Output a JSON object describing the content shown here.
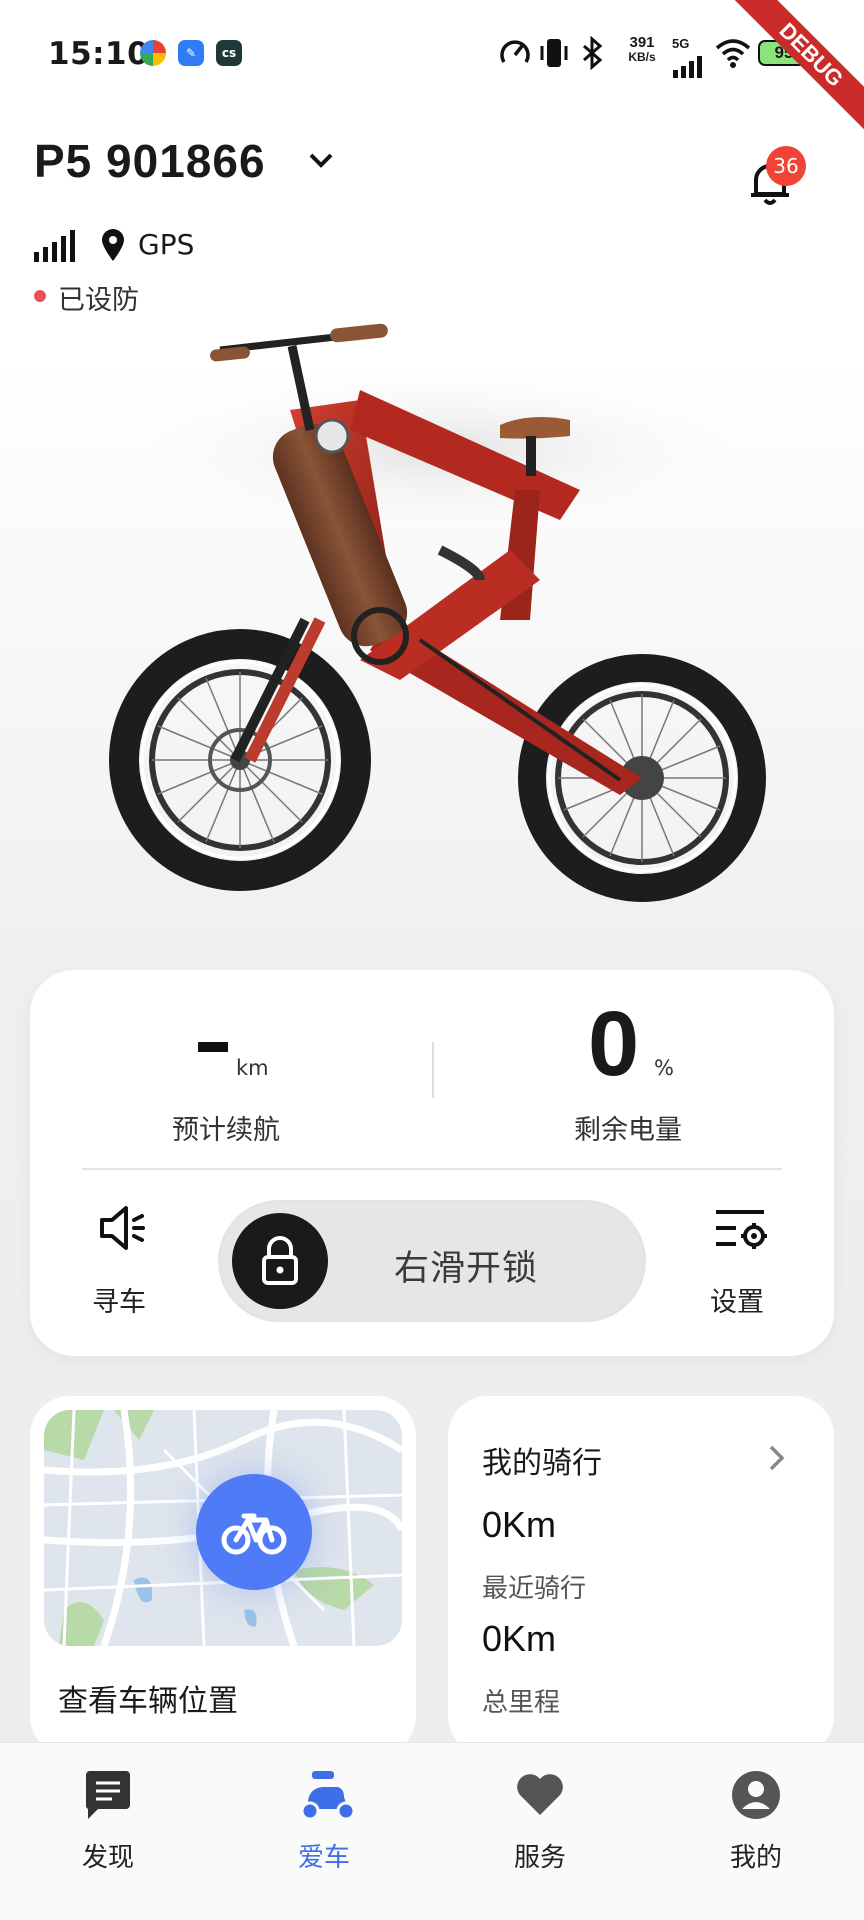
{
  "status_bar": {
    "time": "15:10",
    "net_speed_value": "391",
    "net_speed_unit": "KB/s",
    "network_type": "5G",
    "battery": "95",
    "debug_label": "DEBUG"
  },
  "header": {
    "vehicle_name": "P5 901866",
    "notification_count": "36",
    "gps_label": "GPS",
    "lock_status": "已设防"
  },
  "stats": {
    "range_value": "-",
    "range_unit": "km",
    "range_label": "预计续航",
    "battery_value": "0",
    "battery_unit": "%",
    "battery_label": "剩余电量",
    "find_label": "寻车",
    "slider_label": "右滑开锁",
    "settings_label": "设置"
  },
  "map_card": {
    "caption": "查看车辆位置"
  },
  "ride_card": {
    "title": "我的骑行",
    "recent_value": "0Km",
    "recent_label": "最近骑行",
    "total_value": "0Km",
    "total_label": "总里程"
  },
  "nav": {
    "items": [
      {
        "label": "发现",
        "icon": "chat-icon"
      },
      {
        "label": "爱车",
        "icon": "scooter-icon"
      },
      {
        "label": "服务",
        "icon": "heart-icon"
      },
      {
        "label": "我的",
        "icon": "person-icon"
      }
    ],
    "active_index": 1
  },
  "colors": {
    "accent": "#3e6ee8",
    "map_marker": "#4f7cf6",
    "badge": "#f04438",
    "armed_dot": "#e8505a",
    "bike_frame": "#b3291f"
  }
}
